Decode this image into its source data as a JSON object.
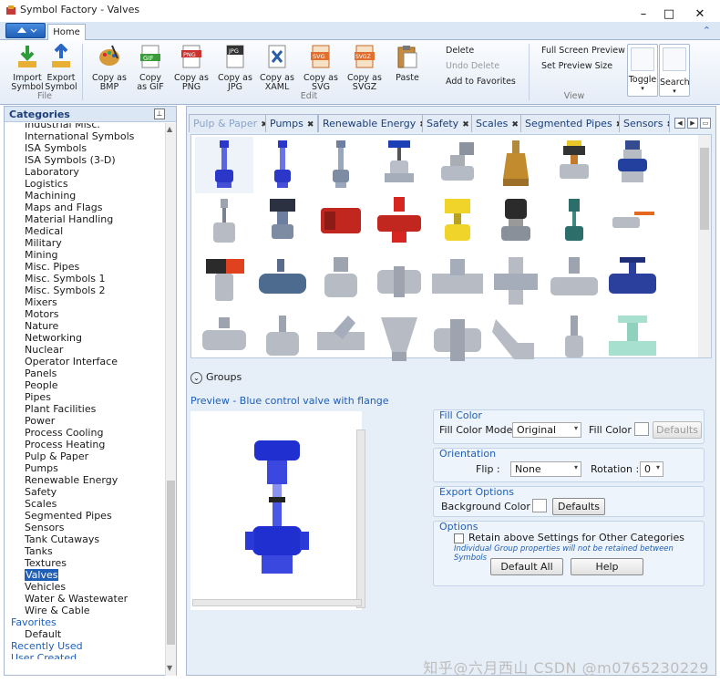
{
  "window": {
    "title": "Symbol Factory - Valves",
    "minimize": "–",
    "maximize": "□",
    "close": "✕"
  },
  "ribbon": {
    "tab": "Home",
    "buttons": [
      {
        "label": "Import\nSymbol",
        "icon": "import-icon"
      },
      {
        "label": "Export\nSymbol",
        "icon": "export-icon"
      },
      {
        "label": "Copy as\nBMP",
        "icon": "bmp-icon"
      },
      {
        "label": "Copy\nas GIF",
        "icon": "gif-icon"
      },
      {
        "label": "Copy as\nPNG",
        "icon": "png-icon"
      },
      {
        "label": "Copy as\nJPG",
        "icon": "jpg-icon"
      },
      {
        "label": "Copy as\nXAML",
        "icon": "xaml-icon"
      },
      {
        "label": "Copy as\nSVG",
        "icon": "svg-icon"
      },
      {
        "label": "Copy as\nSVGZ",
        "icon": "svgz-icon"
      },
      {
        "label": "Paste",
        "icon": "paste-icon"
      }
    ],
    "file_group": "File",
    "edit_group": "Edit",
    "view_group": "View",
    "delete": "Delete",
    "undo_delete": "Undo Delete",
    "add_favorites": "Add to Favorites",
    "full_screen": "Full Screen Preview",
    "set_preview_size": "Set Preview Size",
    "toggle": "Toggle",
    "search": "Search"
  },
  "categories": {
    "title": "Categories",
    "items": [
      "Industrial Misc.",
      "International Symbols",
      "ISA Symbols",
      "ISA Symbols (3-D)",
      "Laboratory",
      "Logistics",
      "Machining",
      "Maps and Flags",
      "Material Handling",
      "Medical",
      "Military",
      "Mining",
      "Misc. Pipes",
      "Misc. Symbols 1",
      "Misc. Symbols 2",
      "Mixers",
      "Motors",
      "Nature",
      "Networking",
      "Nuclear",
      "Operator Interface",
      "Panels",
      "People",
      "Pipes",
      "Plant Facilities",
      "Power",
      "Process Cooling",
      "Process Heating",
      "Pulp & Paper",
      "Pumps",
      "Renewable Energy",
      "Safety",
      "Scales",
      "Segmented Pipes",
      "Sensors",
      "Tank Cutaways",
      "Tanks",
      "Textures",
      "Valves",
      "Vehicles",
      "Water & Wastewater",
      "Wire & Cable"
    ],
    "selected": "Valves",
    "favorites": "Favorites",
    "default": "Default",
    "recently_used": "Recently Used",
    "user_created": "User Created"
  },
  "tabs": [
    "Pulp & Paper",
    "Pumps",
    "Renewable Energy",
    "Safety",
    "Scales",
    "Segmented Pipes",
    "Sensors"
  ],
  "groups_label": "Groups",
  "preview_title": "Preview - Blue control valve with flange",
  "fill_color": {
    "header": "Fill Color",
    "mode_label": "Fill Color Mode",
    "mode_value": "Original",
    "color_label": "Fill Color",
    "defaults": "Defaults"
  },
  "orientation": {
    "header": "Orientation",
    "flip_label": "Flip :",
    "flip_value": "None",
    "rotation_label": "Rotation :",
    "rotation_value": "0"
  },
  "export_options": {
    "header": "Export Options",
    "bg_label": "Background Color :",
    "defaults": "Defaults"
  },
  "options": {
    "header": "Options",
    "retain": "Retain above Settings for Other Categories",
    "note": "Individual Group properties will not be retained between Symbols",
    "default_all": "Default All",
    "help": "Help"
  },
  "watermark": "知乎@六月西山 CSDN @m0765230229"
}
